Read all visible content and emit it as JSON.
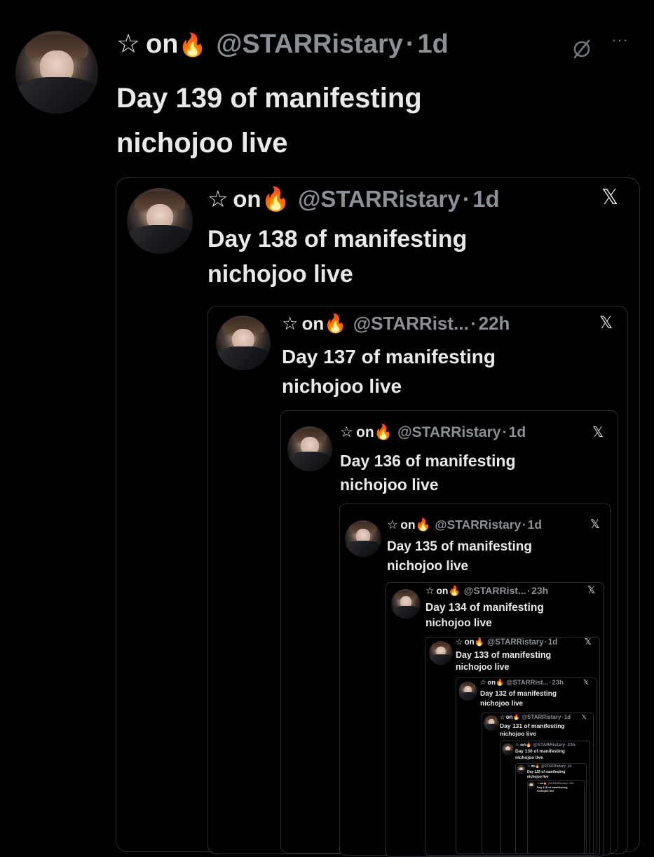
{
  "main_tweet": {
    "star": "☆",
    "display_name": "on",
    "emoji": "🔥",
    "handle": "@STARRistary",
    "separator": "·",
    "time": "1d",
    "line1": "Day 139 of manifesting",
    "line2": "nichojoo live",
    "more_icon": "more-icon",
    "grok_icon": "slash-circle-icon"
  },
  "quotes": [
    {
      "handle": "@STARRistary",
      "time": "1d",
      "line1": "Day 138 of manifesting",
      "line2": "nichojoo live",
      "close": "𝕏"
    },
    {
      "handle": "@STARRist...",
      "time": "22h",
      "line1": "Day 137 of manifesting",
      "line2": "nichojoo live",
      "close": "𝕏"
    },
    {
      "handle": "@STARRistary",
      "time": "1d",
      "line1": "Day 136 of manifesting",
      "line2": "nichojoo live",
      "close": "𝕏"
    },
    {
      "handle": "@STARRistary",
      "time": "1d",
      "line1": "Day 135 of manifesting",
      "line2": "nichojoo live",
      "close": "𝕏"
    },
    {
      "handle": "@STARRist...",
      "time": "23h",
      "line1": "Day 134 of manifesting",
      "line2": "nichojoo live",
      "close": "𝕏"
    },
    {
      "handle": "@STARRistary",
      "time": "1d",
      "line1": "Day 133 of manifesting",
      "line2": "nichojoo live",
      "close": "𝕏"
    },
    {
      "handle": "@STARRist...",
      "time": "23h",
      "line1": "Day 132 of manifesting",
      "line2": "nichojoo live",
      "close": "𝕏"
    },
    {
      "handle": "@STARRistary",
      "time": "1d",
      "line1": "Day 131 of manifesting",
      "line2": "nichojoo live",
      "close": "𝕏"
    },
    {
      "handle": "@STARRistary",
      "time": "23h",
      "line1": "Day 130 of manifesting",
      "line2": "nichojoo live",
      "close": ""
    },
    {
      "handle": "@STARRistary",
      "time": "1d",
      "line1": "Day 129 of manifesting",
      "line2": "nichojoo live",
      "close": ""
    },
    {
      "handle": "@STARRistary",
      "time": "23h",
      "line1": "Day 128 of manifesting",
      "line2": "nichojoo live",
      "close": ""
    }
  ],
  "shared": {
    "star": "☆",
    "display_name": "on",
    "emoji": "🔥",
    "separator": "·"
  }
}
